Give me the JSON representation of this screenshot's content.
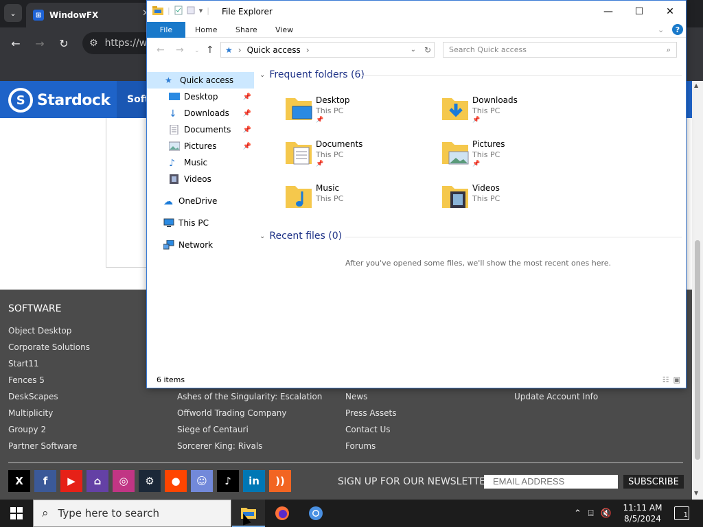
{
  "browser": {
    "tab_title": "WindowFX",
    "url": "https://w",
    "icons": [
      "tab-dropdown-icon",
      "back-icon",
      "forward-icon",
      "reload-icon",
      "site-info-icon"
    ]
  },
  "site": {
    "brand": "Stardock",
    "nav_label": "Softw",
    "footer": {
      "software_heading": "SOFTWARE",
      "software_links": [
        "Object Desktop",
        "Corporate Solutions",
        "Start11",
        "Fences 5",
        "DeskScapes",
        "Multiplicity",
        "Groupy 2",
        "Partner Software"
      ],
      "games_links": [
        "Ashes of the Singularity: Escalation",
        "Offworld Trading Company",
        "Siege of Centauri",
        "Sorcerer King: Rivals"
      ],
      "company_links": [
        "News",
        "Press Assets",
        "Contact Us",
        "Forums"
      ],
      "account_links": [
        "Update Account Info"
      ],
      "newsletter_label": "SIGN UP FOR OUR NEWSLETTER:",
      "email_placeholder": "EMAIL ADDRESS",
      "subscribe_label": "SUBSCRIBE",
      "social": [
        {
          "name": "x",
          "glyph": "X",
          "color": "#000000"
        },
        {
          "name": "facebook",
          "glyph": "f",
          "color": "#3b5998"
        },
        {
          "name": "youtube",
          "glyph": "▶",
          "color": "#e62117"
        },
        {
          "name": "twitch",
          "glyph": "⌂",
          "color": "#6441a5"
        },
        {
          "name": "instagram",
          "glyph": "◎",
          "color": "#c13584"
        },
        {
          "name": "steam",
          "glyph": "⚙",
          "color": "#1b2838"
        },
        {
          "name": "reddit",
          "glyph": "●",
          "color": "#ff4500"
        },
        {
          "name": "discord",
          "glyph": "☺",
          "color": "#7289da"
        },
        {
          "name": "tiktok",
          "glyph": "♪",
          "color": "#000000"
        },
        {
          "name": "linkedin",
          "glyph": "in",
          "color": "#0077b5"
        },
        {
          "name": "rss",
          "glyph": "))",
          "color": "#f26522"
        }
      ]
    }
  },
  "explorer": {
    "title": "File Explorer",
    "ribbon_tabs": [
      "File",
      "Home",
      "Share",
      "View"
    ],
    "address": "Quick access",
    "search_placeholder": "Search Quick access",
    "nav": {
      "quick_access": "Quick access",
      "items": [
        {
          "label": "Desktop",
          "pinned": true
        },
        {
          "label": "Downloads",
          "pinned": true
        },
        {
          "label": "Documents",
          "pinned": true
        },
        {
          "label": "Pictures",
          "pinned": true
        },
        {
          "label": "Music",
          "pinned": false
        },
        {
          "label": "Videos",
          "pinned": false
        }
      ],
      "onedrive": "OneDrive",
      "this_pc": "This PC",
      "network": "Network"
    },
    "frequent_heading": "Frequent folders (6)",
    "folders": [
      {
        "name": "Desktop",
        "location": "This PC",
        "pinned": true
      },
      {
        "name": "Downloads",
        "location": "This PC",
        "pinned": true
      },
      {
        "name": "Documents",
        "location": "This PC",
        "pinned": true
      },
      {
        "name": "Pictures",
        "location": "This PC",
        "pinned": true
      },
      {
        "name": "Music",
        "location": "This PC",
        "pinned": false
      },
      {
        "name": "Videos",
        "location": "This PC",
        "pinned": false
      }
    ],
    "recent_heading": "Recent files (0)",
    "recent_empty": "After you've opened some files, we'll show the most recent ones here.",
    "status": "6 items"
  },
  "taskbar": {
    "search_placeholder": "Type here to search",
    "time": "11:11 AM",
    "date": "8/5/2024",
    "notification_count": "1"
  },
  "colors": {
    "accent": "#1979ca",
    "stardock_blue": "#1e63c8",
    "footer_bg": "#4b4b4b"
  }
}
